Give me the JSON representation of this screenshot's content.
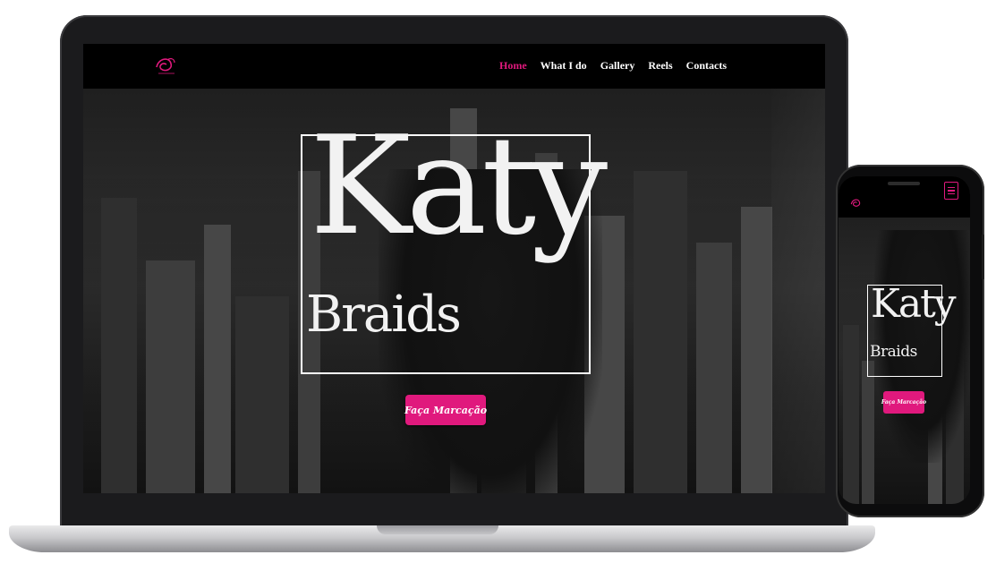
{
  "brand": {
    "logo_icon": "katy-braids-logo-icon",
    "accent_color": "#e0197d"
  },
  "nav": {
    "items": [
      {
        "label": "Home",
        "active": true
      },
      {
        "label": "What I do",
        "active": false
      },
      {
        "label": "Gallery",
        "active": false
      },
      {
        "label": "Reels",
        "active": false
      },
      {
        "label": "Contacts",
        "active": false
      }
    ]
  },
  "hero": {
    "title_line1": "Katy",
    "title_line2": "Braids",
    "cta_label": "Faça Marcação"
  },
  "mobile": {
    "menu_icon": "hamburger-menu-icon",
    "title_line1": "Katy",
    "title_line2": "Braids",
    "cta_label": "Faça Marcação"
  }
}
